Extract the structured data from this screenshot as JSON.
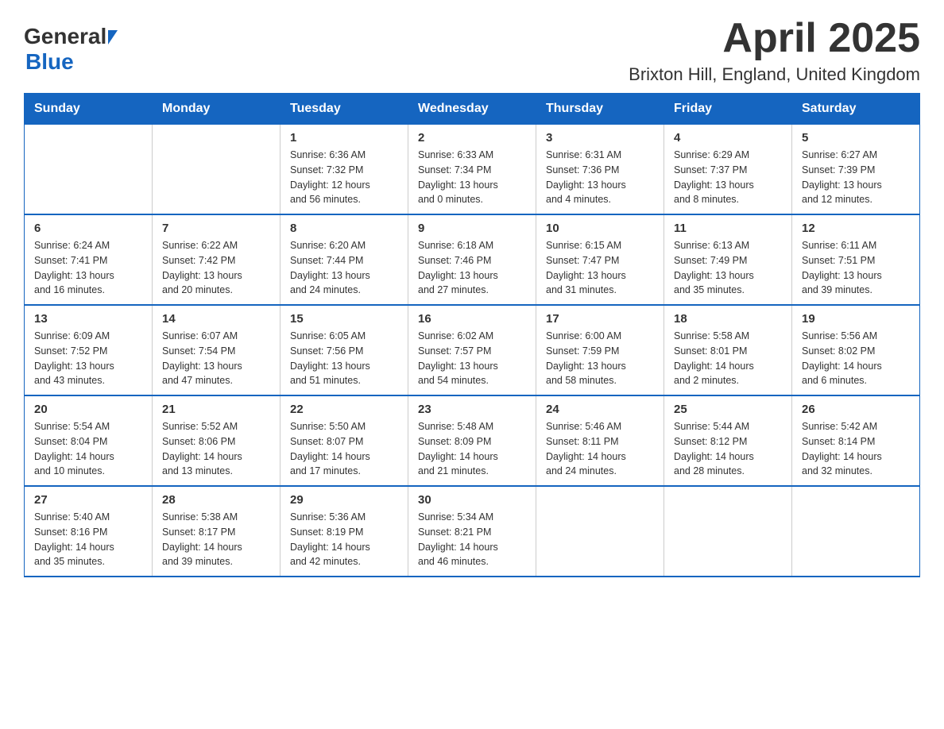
{
  "header": {
    "logo_general": "General",
    "logo_blue": "Blue",
    "month_title": "April 2025",
    "location": "Brixton Hill, England, United Kingdom"
  },
  "days_of_week": [
    "Sunday",
    "Monday",
    "Tuesday",
    "Wednesday",
    "Thursday",
    "Friday",
    "Saturday"
  ],
  "weeks": [
    [
      {
        "day": "",
        "sunrise": "",
        "sunset": "",
        "daylight": ""
      },
      {
        "day": "",
        "sunrise": "",
        "sunset": "",
        "daylight": ""
      },
      {
        "day": "1",
        "sunrise": "Sunrise: 6:36 AM",
        "sunset": "Sunset: 7:32 PM",
        "daylight": "Daylight: 12 hours and 56 minutes."
      },
      {
        "day": "2",
        "sunrise": "Sunrise: 6:33 AM",
        "sunset": "Sunset: 7:34 PM",
        "daylight": "Daylight: 13 hours and 0 minutes."
      },
      {
        "day": "3",
        "sunrise": "Sunrise: 6:31 AM",
        "sunset": "Sunset: 7:36 PM",
        "daylight": "Daylight: 13 hours and 4 minutes."
      },
      {
        "day": "4",
        "sunrise": "Sunrise: 6:29 AM",
        "sunset": "Sunset: 7:37 PM",
        "daylight": "Daylight: 13 hours and 8 minutes."
      },
      {
        "day": "5",
        "sunrise": "Sunrise: 6:27 AM",
        "sunset": "Sunset: 7:39 PM",
        "daylight": "Daylight: 13 hours and 12 minutes."
      }
    ],
    [
      {
        "day": "6",
        "sunrise": "Sunrise: 6:24 AM",
        "sunset": "Sunset: 7:41 PM",
        "daylight": "Daylight: 13 hours and 16 minutes."
      },
      {
        "day": "7",
        "sunrise": "Sunrise: 6:22 AM",
        "sunset": "Sunset: 7:42 PM",
        "daylight": "Daylight: 13 hours and 20 minutes."
      },
      {
        "day": "8",
        "sunrise": "Sunrise: 6:20 AM",
        "sunset": "Sunset: 7:44 PM",
        "daylight": "Daylight: 13 hours and 24 minutes."
      },
      {
        "day": "9",
        "sunrise": "Sunrise: 6:18 AM",
        "sunset": "Sunset: 7:46 PM",
        "daylight": "Daylight: 13 hours and 27 minutes."
      },
      {
        "day": "10",
        "sunrise": "Sunrise: 6:15 AM",
        "sunset": "Sunset: 7:47 PM",
        "daylight": "Daylight: 13 hours and 31 minutes."
      },
      {
        "day": "11",
        "sunrise": "Sunrise: 6:13 AM",
        "sunset": "Sunset: 7:49 PM",
        "daylight": "Daylight: 13 hours and 35 minutes."
      },
      {
        "day": "12",
        "sunrise": "Sunrise: 6:11 AM",
        "sunset": "Sunset: 7:51 PM",
        "daylight": "Daylight: 13 hours and 39 minutes."
      }
    ],
    [
      {
        "day": "13",
        "sunrise": "Sunrise: 6:09 AM",
        "sunset": "Sunset: 7:52 PM",
        "daylight": "Daylight: 13 hours and 43 minutes."
      },
      {
        "day": "14",
        "sunrise": "Sunrise: 6:07 AM",
        "sunset": "Sunset: 7:54 PM",
        "daylight": "Daylight: 13 hours and 47 minutes."
      },
      {
        "day": "15",
        "sunrise": "Sunrise: 6:05 AM",
        "sunset": "Sunset: 7:56 PM",
        "daylight": "Daylight: 13 hours and 51 minutes."
      },
      {
        "day": "16",
        "sunrise": "Sunrise: 6:02 AM",
        "sunset": "Sunset: 7:57 PM",
        "daylight": "Daylight: 13 hours and 54 minutes."
      },
      {
        "day": "17",
        "sunrise": "Sunrise: 6:00 AM",
        "sunset": "Sunset: 7:59 PM",
        "daylight": "Daylight: 13 hours and 58 minutes."
      },
      {
        "day": "18",
        "sunrise": "Sunrise: 5:58 AM",
        "sunset": "Sunset: 8:01 PM",
        "daylight": "Daylight: 14 hours and 2 minutes."
      },
      {
        "day": "19",
        "sunrise": "Sunrise: 5:56 AM",
        "sunset": "Sunset: 8:02 PM",
        "daylight": "Daylight: 14 hours and 6 minutes."
      }
    ],
    [
      {
        "day": "20",
        "sunrise": "Sunrise: 5:54 AM",
        "sunset": "Sunset: 8:04 PM",
        "daylight": "Daylight: 14 hours and 10 minutes."
      },
      {
        "day": "21",
        "sunrise": "Sunrise: 5:52 AM",
        "sunset": "Sunset: 8:06 PM",
        "daylight": "Daylight: 14 hours and 13 minutes."
      },
      {
        "day": "22",
        "sunrise": "Sunrise: 5:50 AM",
        "sunset": "Sunset: 8:07 PM",
        "daylight": "Daylight: 14 hours and 17 minutes."
      },
      {
        "day": "23",
        "sunrise": "Sunrise: 5:48 AM",
        "sunset": "Sunset: 8:09 PM",
        "daylight": "Daylight: 14 hours and 21 minutes."
      },
      {
        "day": "24",
        "sunrise": "Sunrise: 5:46 AM",
        "sunset": "Sunset: 8:11 PM",
        "daylight": "Daylight: 14 hours and 24 minutes."
      },
      {
        "day": "25",
        "sunrise": "Sunrise: 5:44 AM",
        "sunset": "Sunset: 8:12 PM",
        "daylight": "Daylight: 14 hours and 28 minutes."
      },
      {
        "day": "26",
        "sunrise": "Sunrise: 5:42 AM",
        "sunset": "Sunset: 8:14 PM",
        "daylight": "Daylight: 14 hours and 32 minutes."
      }
    ],
    [
      {
        "day": "27",
        "sunrise": "Sunrise: 5:40 AM",
        "sunset": "Sunset: 8:16 PM",
        "daylight": "Daylight: 14 hours and 35 minutes."
      },
      {
        "day": "28",
        "sunrise": "Sunrise: 5:38 AM",
        "sunset": "Sunset: 8:17 PM",
        "daylight": "Daylight: 14 hours and 39 minutes."
      },
      {
        "day": "29",
        "sunrise": "Sunrise: 5:36 AM",
        "sunset": "Sunset: 8:19 PM",
        "daylight": "Daylight: 14 hours and 42 minutes."
      },
      {
        "day": "30",
        "sunrise": "Sunrise: 5:34 AM",
        "sunset": "Sunset: 8:21 PM",
        "daylight": "Daylight: 14 hours and 46 minutes."
      },
      {
        "day": "",
        "sunrise": "",
        "sunset": "",
        "daylight": ""
      },
      {
        "day": "",
        "sunrise": "",
        "sunset": "",
        "daylight": ""
      },
      {
        "day": "",
        "sunrise": "",
        "sunset": "",
        "daylight": ""
      }
    ]
  ]
}
